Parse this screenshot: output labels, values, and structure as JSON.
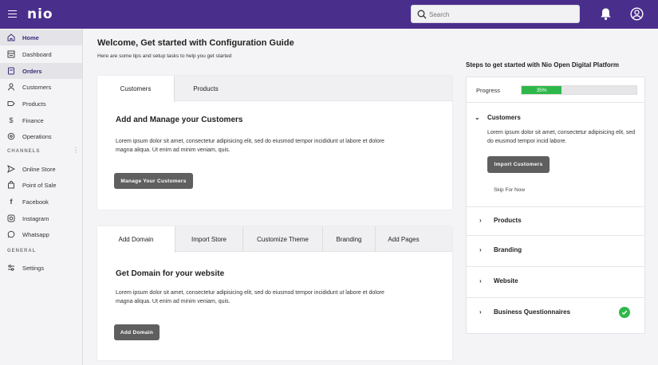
{
  "topbar": {
    "logo": "nio",
    "search_placeholder": "Search"
  },
  "sidebar": {
    "items": [
      {
        "label": "Home",
        "icon": "home-icon"
      },
      {
        "label": "Dashboard",
        "icon": "dashboard-icon"
      },
      {
        "label": "Orders",
        "icon": "orders-icon"
      },
      {
        "label": "Customers",
        "icon": "person-icon"
      },
      {
        "label": "Products",
        "icon": "tag-icon"
      },
      {
        "label": "Finance",
        "icon": "dollar-icon"
      },
      {
        "label": "Operations",
        "icon": "gear-icon"
      }
    ],
    "channels_heading": "CHANNELS",
    "channels": [
      {
        "label": "Online Store",
        "icon": "send-icon"
      },
      {
        "label": "Point of Sale",
        "icon": "bag-icon"
      },
      {
        "label": "Facebook",
        "icon": "facebook-icon"
      },
      {
        "label": "Instagram",
        "icon": "instagram-icon"
      },
      {
        "label": "Whatsapp",
        "icon": "whatsapp-icon"
      }
    ],
    "general_heading": "GENERAL",
    "general": [
      {
        "label": "Settings",
        "icon": "settings-icon"
      }
    ]
  },
  "main": {
    "title": "Welcome, Get started with Configuration Guide",
    "subtitle": "Here are some tips and setup tasks to help you get started"
  },
  "card1": {
    "tabs": [
      "Customers",
      "Products"
    ],
    "heading": "Add and Manage your Customers",
    "body": "Lorem ipsum dolor sit amet, consectetur adipisicing elit, sed do eiusmod tempor incididunt ut labore et dolore magna aliqua. Ut enim ad minim veniam, quis.",
    "button": "Manage Your Customers"
  },
  "card2": {
    "tabs": [
      "Add Domain",
      "Import Store",
      "Customize Theme",
      "Branding",
      "Add Pages"
    ],
    "heading": "Get Domain for your website",
    "body": "Lorem ipsum dolor sit amet, consectetur adipisicing elit, sed do eiusmod tempor incididunt ut labore et dolore magna aliqua. Ut enim ad minim veniam, quis.",
    "button": "Add Domain"
  },
  "steps": {
    "title": "Steps to get started with Nio Open Digital Platform",
    "progress_label": "Progress",
    "progress_text": "35%",
    "progress_value": 0.35,
    "expanded": {
      "label": "Customers",
      "desc": "Lorem ipsum dolor sit amet, consectetur adipisicing elit, sed do eiusmod tempor incid labore.",
      "button": "Import Customers",
      "skip": "Skip For Now"
    },
    "items": [
      "Products",
      "Branding",
      "Website",
      "Business Questionnaires"
    ]
  },
  "colors": {
    "topbar": "#4a2e8c",
    "progress": "#2fb84a"
  }
}
